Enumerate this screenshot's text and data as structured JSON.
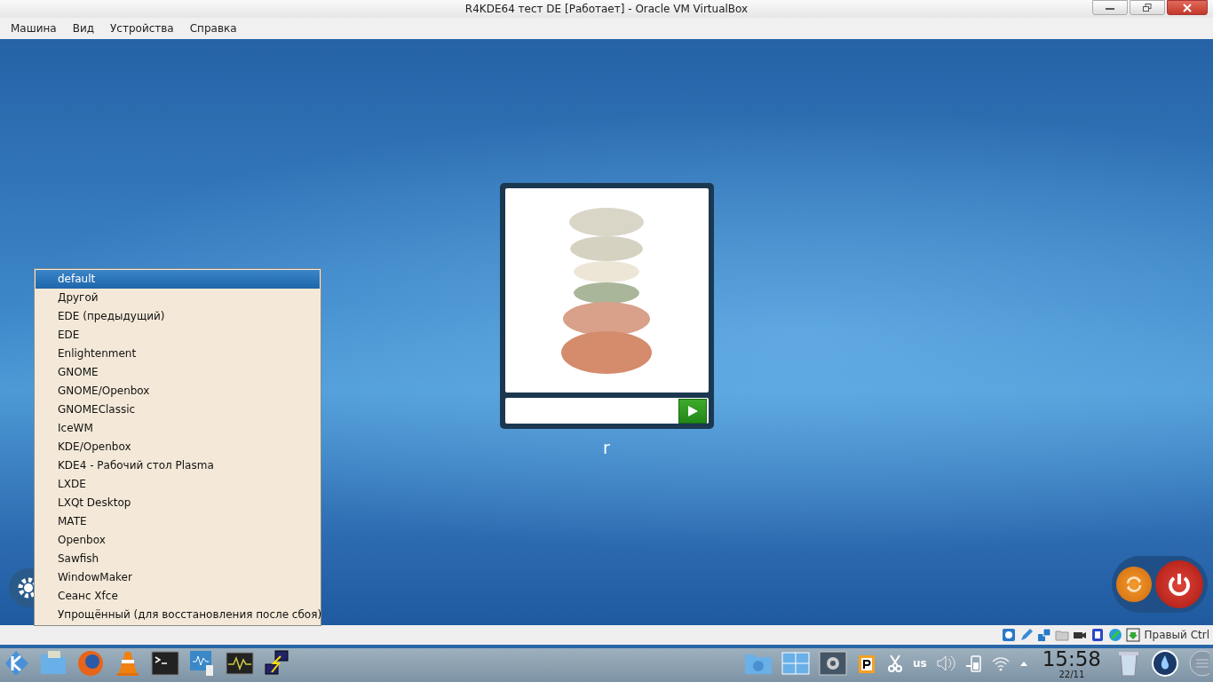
{
  "window": {
    "title": "R4KDE64 тест DE [Работает] - Oracle VM VirtualBox"
  },
  "menu": [
    "Машина",
    "Вид",
    "Устройства",
    "Справка"
  ],
  "login": {
    "username": "r"
  },
  "session_menu": [
    {
      "label": "default",
      "selected": true
    },
    {
      "label": "Другой",
      "selected": false
    },
    {
      "label": "EDE (предыдущий)",
      "selected": false
    },
    {
      "label": "EDE",
      "selected": false
    },
    {
      "label": "Enlightenment",
      "selected": false
    },
    {
      "label": "GNOME",
      "selected": false
    },
    {
      "label": "GNOME/Openbox",
      "selected": false
    },
    {
      "label": "GNOMEClassic",
      "selected": false
    },
    {
      "label": "IceWM",
      "selected": false
    },
    {
      "label": "KDE/Openbox",
      "selected": false
    },
    {
      "label": "KDE4 - Рабочий стол Plasma",
      "selected": false
    },
    {
      "label": "LXDE",
      "selected": false
    },
    {
      "label": "LXQt Desktop",
      "selected": false
    },
    {
      "label": "MATE",
      "selected": false
    },
    {
      "label": "Openbox",
      "selected": false
    },
    {
      "label": "Sawfish",
      "selected": false
    },
    {
      "label": "WindowMaker",
      "selected": false
    },
    {
      "label": "Сеанс Xfce",
      "selected": false
    },
    {
      "label": "Упрощённый (для восстановления после сбоя)",
      "selected": false
    }
  ],
  "status_bar": {
    "host_key": "Правый Ctrl"
  },
  "taskbar": {
    "keyboard_layout": "us",
    "time": "15:58",
    "date": "22/11"
  }
}
